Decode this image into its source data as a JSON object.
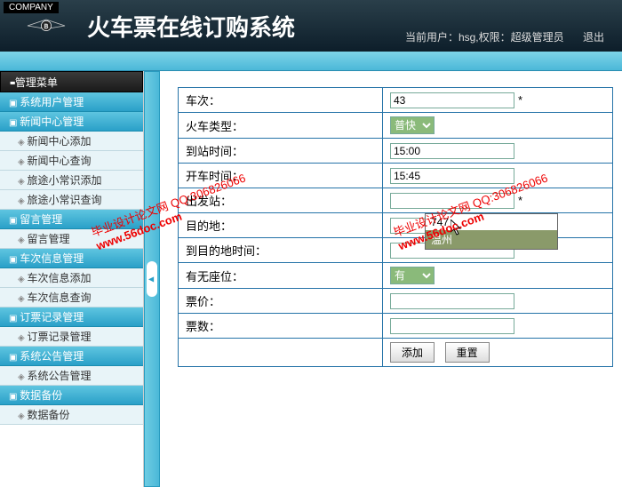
{
  "header": {
    "company_tag": "COMPANY",
    "title": "火车票在线订购系统",
    "current_user_label": "当前用户：hsg,权限：超级管理员",
    "logout": "退出"
  },
  "sidebar": {
    "menu_title": "管理菜单",
    "groups": [
      {
        "label": "系统用户管理",
        "items": []
      },
      {
        "label": "新闻中心管理",
        "items": [
          "新闻中心添加",
          "新闻中心查询",
          "旅途小常识添加",
          "旅途小常识查询"
        ]
      },
      {
        "label": "留言管理",
        "items": [
          "留言管理"
        ]
      },
      {
        "label": "车次信息管理",
        "items": [
          "车次信息添加",
          "车次信息查询"
        ]
      },
      {
        "label": "订票记录管理",
        "items": [
          "订票记录管理"
        ]
      },
      {
        "label": "系统公告管理",
        "items": [
          "系统公告管理"
        ]
      },
      {
        "label": "数据备份",
        "items": [
          "数据备份"
        ]
      }
    ]
  },
  "form": {
    "rows": [
      {
        "label": "车次：",
        "type": "text",
        "value": "43",
        "req": true
      },
      {
        "label": "火车类型：",
        "type": "select",
        "value": "普快",
        "req": false
      },
      {
        "label": "到站时间：",
        "type": "text",
        "value": "15:00",
        "req": false
      },
      {
        "label": "开车时间：",
        "type": "text",
        "value": "15:45",
        "req": false
      },
      {
        "label": "出发站：",
        "type": "text",
        "value": "",
        "req": true
      },
      {
        "label": "目的地：",
        "type": "text",
        "value": "",
        "req": true
      },
      {
        "label": "到目的地时间：",
        "type": "text",
        "value": "",
        "req": false
      },
      {
        "label": "有无座位：",
        "type": "select",
        "value": "有",
        "req": false
      },
      {
        "label": "票价：",
        "type": "text",
        "value": "",
        "req": false
      },
      {
        "label": "票数：",
        "type": "text",
        "value": "",
        "req": false
      }
    ],
    "dropdown": {
      "items": [
        "747",
        "温州"
      ]
    },
    "buttons": {
      "submit": "添加",
      "reset": "重置"
    }
  },
  "watermark": {
    "line1": "毕业设计论文网",
    "line2": "QQ:306826066",
    "url": "www.56doc.com"
  }
}
